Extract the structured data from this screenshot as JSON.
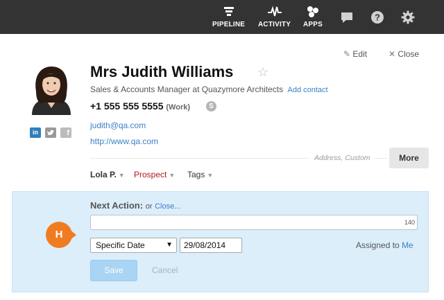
{
  "topnav": {
    "items": [
      {
        "label": "PIPELINE",
        "icon": "pipeline-icon"
      },
      {
        "label": "ACTIVITY",
        "icon": "activity-icon"
      },
      {
        "label": "APPS",
        "icon": "apps-icon"
      }
    ],
    "icons": [
      "chat-icon",
      "help-icon",
      "gear-icon"
    ]
  },
  "actions": {
    "edit": "Edit",
    "close": "Close"
  },
  "contact": {
    "name": "Mrs Judith Williams",
    "job_title": "Sales & Accounts Manager at Quazymore Architects",
    "add_contact": "Add contact",
    "phone": "+1 555 555 5555",
    "phone_type": "(Work)",
    "email": "judith@qa.com",
    "website": "http://www.qa.com",
    "extra_fields": "Address, Custom",
    "more": "More",
    "social": [
      "linkedin-icon",
      "twitter-icon",
      "facebook-icon"
    ]
  },
  "tags": {
    "owner": "Lola P.",
    "status": "Prospect",
    "tags": "Tags"
  },
  "next_action": {
    "label": "Next Action:",
    "or": "or",
    "close": "Close...",
    "counter": "140",
    "date_type": "Specific Date",
    "date": "29/08/2014",
    "assigned_to": "Assigned to",
    "assignee": "Me",
    "save": "Save",
    "cancel": "Cancel",
    "badge": "H"
  },
  "colors": {
    "topbar": "#333333",
    "link": "#3b7fc4",
    "status": "#b5141e",
    "panel": "#dbeefa",
    "badge": "#f07c22"
  }
}
